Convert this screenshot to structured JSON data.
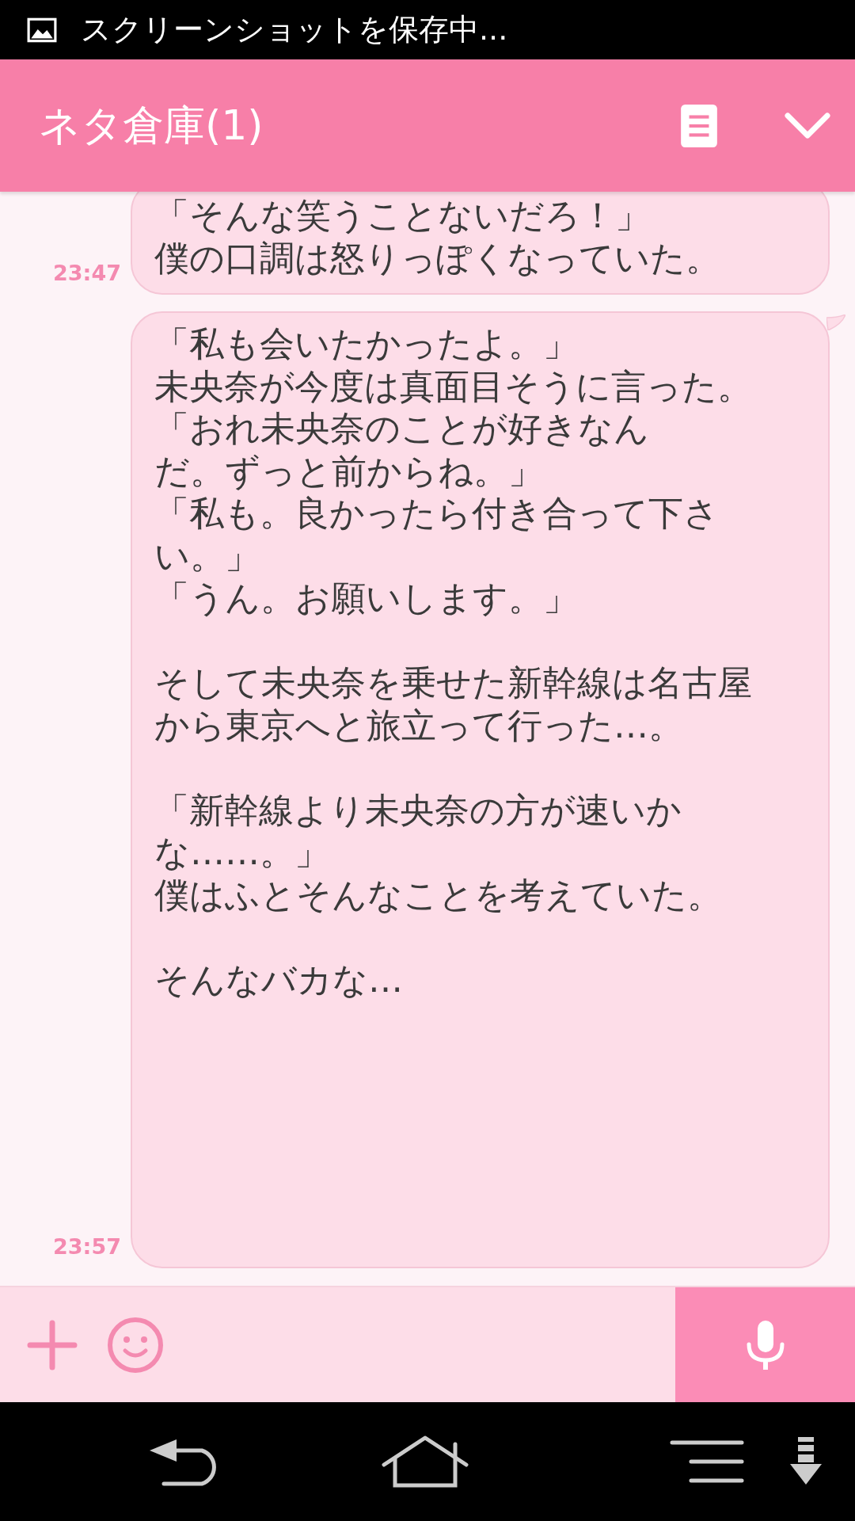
{
  "status_bar": {
    "text": "スクリーンショットを保存中..."
  },
  "header": {
    "title": "ネタ倉庫(1)"
  },
  "messages": [
    {
      "time": "23:47",
      "tail": false,
      "paragraphs": [
        [
          "「そんな笑うことないだろ！」",
          "僕の口調は怒りっぽくなっていた。"
        ]
      ]
    },
    {
      "time": "23:57",
      "tail": true,
      "paragraphs": [
        [
          "「私も会いたかったよ。」",
          "未央奈が今度は真面目そうに言った。",
          "「おれ未央奈のことが好きなん",
          "だ。ずっと前からね。」",
          "「私も。良かったら付き合って下さ",
          "い。」",
          "「うん。お願いします。」"
        ],
        [
          "そして未央奈を乗せた新幹線は名古屋",
          "から東京へと旅立って行った…。"
        ],
        [
          "「新幹線より未央奈の方が速いか",
          "な……。」",
          "僕はふとそんなことを考えていた。"
        ],
        [
          "そんなバカな…"
        ]
      ]
    }
  ]
}
